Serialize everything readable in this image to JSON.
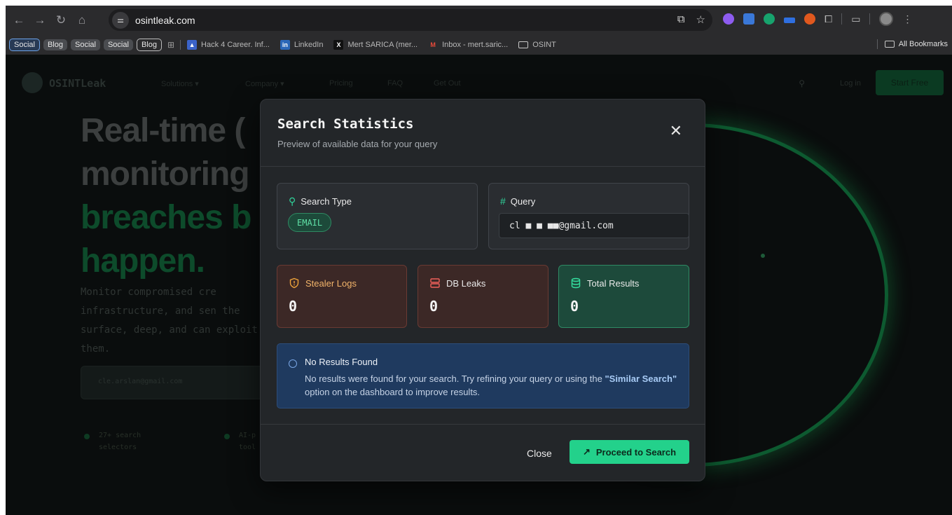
{
  "browser": {
    "url": "osintleak.com",
    "bookmarks": {
      "chips": [
        "Social",
        "Blog",
        "Social",
        "Social",
        "Blog"
      ],
      "items": [
        {
          "label": "Hack 4 Career. Inf...",
          "icon": "hack4career-icon"
        },
        {
          "label": "LinkedIn",
          "icon": "linkedin-icon"
        },
        {
          "label": "Mert SARICA (mer...",
          "icon": "x-icon"
        },
        {
          "label": "Inbox - mert.saric...",
          "icon": "gmail-icon"
        },
        {
          "label": "OSINT",
          "icon": "folder-icon"
        }
      ],
      "all_bookmarks": "All Bookmarks"
    }
  },
  "page": {
    "logo": "OSINTLeak",
    "nav": [
      "Solutions ▾",
      "Company ▾",
      "Pricing",
      "FAQ",
      "Get Out"
    ],
    "login": "Log in",
    "signup": "Start Free",
    "hero_lines": [
      "Real-time (",
      "monitoring",
      "breaches b",
      "happen."
    ],
    "hero_sub": "Monitor compromised cre infrastructure, and sen the surface, deep, and can exploit them.",
    "hero_input": "cle.arslan@gmail.com",
    "features": [
      "27+ search selectors",
      "AI-p tool"
    ]
  },
  "modal": {
    "title": "Search Statistics",
    "subtitle": "Preview of available data for your query",
    "search_type": {
      "label": "Search Type",
      "value": "EMAIL"
    },
    "query": {
      "label": "Query",
      "value": "cl  ■  ■ ■■@gmail.com"
    },
    "stats": [
      {
        "label": "Stealer Logs",
        "value": "0",
        "icon": "shield-alert-icon"
      },
      {
        "label": "DB Leaks",
        "value": "0",
        "icon": "server-icon"
      },
      {
        "label": "Total Results",
        "value": "0",
        "icon": "database-icon"
      }
    ],
    "notice": {
      "title": "No Results Found",
      "body_prefix": "No results were found for your search. Try refining your query or using the ",
      "body_bold": "\"Similar Search\"",
      "body_suffix": " option on the dashboard to improve results."
    },
    "close_label": "Close",
    "proceed_label": "Proceed to Search"
  },
  "colors": {
    "accent": "#23d18b",
    "danger_bg": "#3c2826",
    "info_bg": "#1f3a5f"
  }
}
